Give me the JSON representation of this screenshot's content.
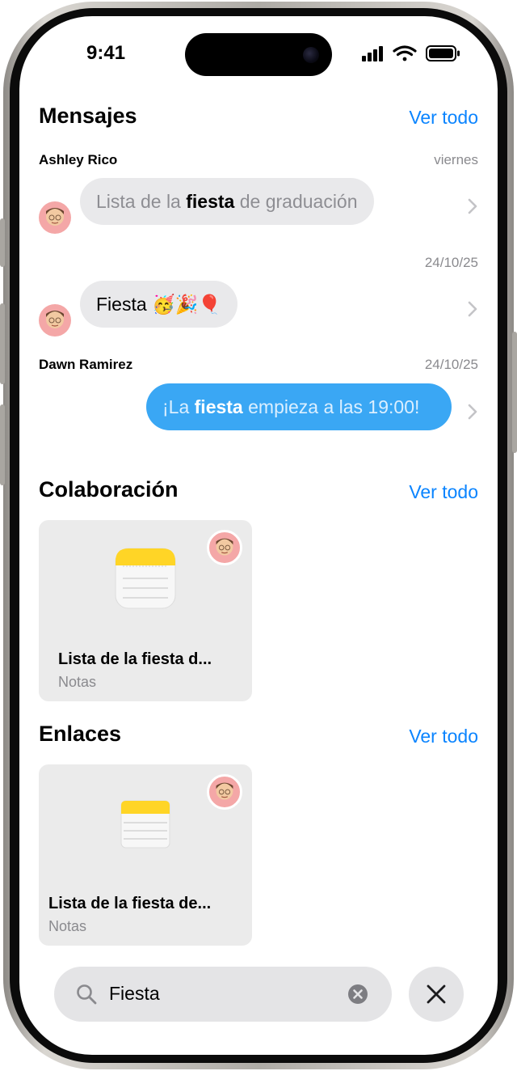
{
  "status_bar": {
    "time": "9:41"
  },
  "messages": {
    "title": "Mensajes",
    "see_all": "Ver todo",
    "items": [
      {
        "sender": "Ashley Rico",
        "date": "viernes",
        "pre": "Lista de la ",
        "highlight": "fiesta",
        "post": " de graduación"
      },
      {
        "sender": "",
        "date": "24/10/25",
        "pre": "",
        "highlight": "Fiesta",
        "post": " 🥳🎉🎈"
      },
      {
        "sender": "Dawn Ramirez",
        "date": "24/10/25",
        "pre": "¡La ",
        "highlight": "fiesta",
        "post": " empieza a las 19:00!"
      }
    ]
  },
  "collaboration": {
    "title": "Colaboración",
    "see_all": "Ver todo",
    "card": {
      "title": "Lista de la fiesta d...",
      "app": "Notas"
    }
  },
  "links": {
    "title": "Enlaces",
    "see_all": "Ver todo",
    "card": {
      "title": "Lista de la fiesta de...",
      "app": "Notas"
    }
  },
  "search": {
    "query": "Fiesta"
  },
  "colors": {
    "accent": "#0a84ff",
    "sent_bubble": "#3aa7f4",
    "received_bubble": "#e9e9eb"
  },
  "icons": [
    "search-icon",
    "clear-icon",
    "close-icon",
    "chevron-right-icon",
    "notes-icon",
    "memoji-avatar"
  ]
}
